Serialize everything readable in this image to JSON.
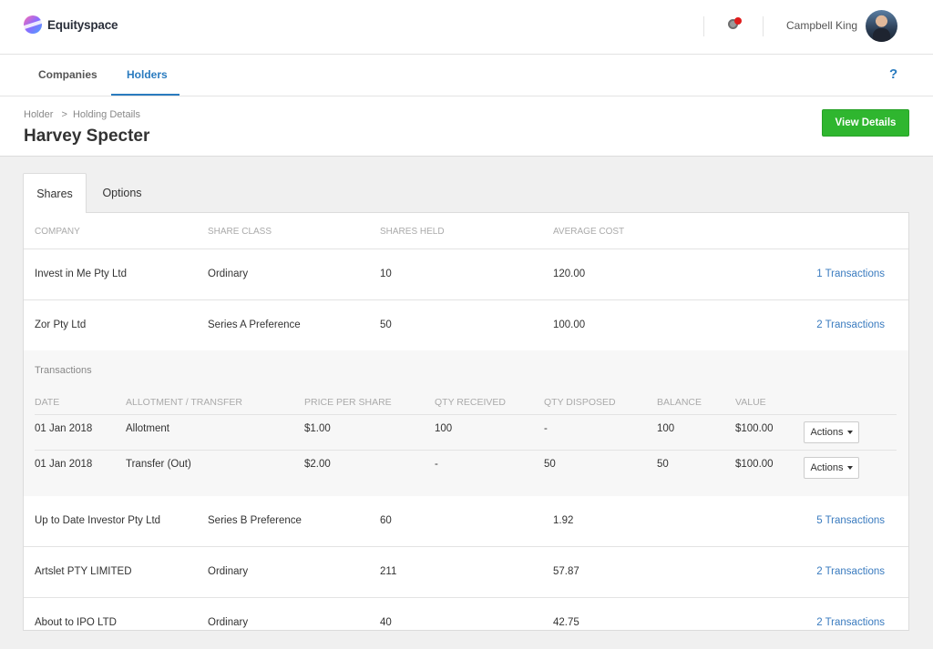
{
  "app": {
    "logo_text": "Equityspace"
  },
  "user": {
    "name": "Campbell King"
  },
  "nav": {
    "tabs": [
      {
        "label": "Companies"
      },
      {
        "label": "Holders"
      }
    ],
    "help": "?"
  },
  "page": {
    "breadcrumb_root": "Holder",
    "breadcrumb_sep": ">",
    "breadcrumb_current": "Holding Details",
    "title": "Harvey Specter",
    "view_details_label": "View Details"
  },
  "tabs": [
    {
      "label": "Shares"
    },
    {
      "label": "Options"
    }
  ],
  "table": {
    "headers": [
      "COMPANY",
      "SHARE CLASS",
      "SHARES HELD",
      "AVERAGE COST"
    ],
    "rows": [
      {
        "company": "Invest in Me Pty Ltd",
        "share_class": "Ordinary",
        "shares_held": "10",
        "average_cost": "120.00",
        "transactions": "1 Transactions"
      },
      {
        "company": "Zor Pty Ltd",
        "share_class": "Series A Preference",
        "shares_held": "50",
        "average_cost": "100.00",
        "transactions": "2 Transactions"
      },
      {
        "company": "Up to Date Investor Pty Ltd",
        "share_class": "Series B Preference",
        "shares_held": "60",
        "average_cost": "1.92",
        "transactions": "5 Transactions"
      },
      {
        "company": "Artslet PTY LIMITED",
        "share_class": "Ordinary",
        "shares_held": "211",
        "average_cost": "57.87",
        "transactions": "2 Transactions"
      },
      {
        "company": "About to IPO LTD",
        "share_class": "Ordinary",
        "shares_held": "40",
        "average_cost": "42.75",
        "transactions": "2 Transactions"
      }
    ]
  },
  "transactions": {
    "title": "Transactions",
    "headers": [
      "DATE",
      "ALLOTMENT / TRANSFER",
      "PRICE PER SHARE",
      "QTY RECEIVED",
      "QTY DISPOSED",
      "BALANCE",
      "VALUE"
    ],
    "rows": [
      {
        "date": "01 Jan 2018",
        "type": "Allotment",
        "price": "$1.00",
        "qty_received": "100",
        "qty_disposed": "-",
        "balance": "100",
        "value": "$100.00",
        "actions": "Actions"
      },
      {
        "date": "01 Jan 2018",
        "type": "Transfer (Out)",
        "price": "$2.00",
        "qty_received": "-",
        "qty_disposed": "50",
        "balance": "50",
        "value": "$100.00",
        "actions": "Actions"
      }
    ]
  },
  "colors": {
    "accent": "#2a7bbf",
    "primary_button": "#2fb62f",
    "notification": "#e01c1c"
  }
}
